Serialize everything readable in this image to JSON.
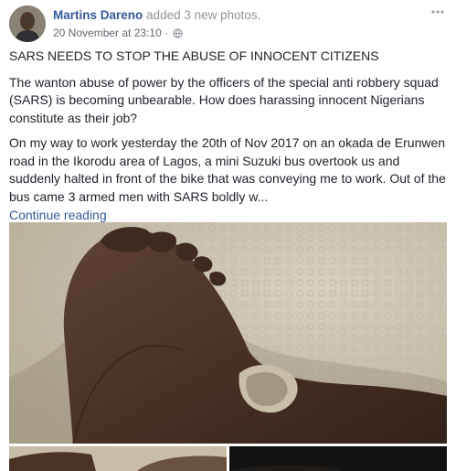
{
  "post": {
    "author": "Martins Dareno",
    "action": "added 3 new photos.",
    "timestamp": "20 November at 23:10",
    "separator": "·",
    "privacy_icon": "globe-icon",
    "more_icon": "more-options-icon",
    "title": "SARS NEEDS TO STOP THE ABUSE OF INNOCENT CITIZENS",
    "paragraph_1": "The wanton abuse of power by the officers of the special anti robbery squad (SARS) is becoming unbearable. How does harassing innocent Nigerians constitute as their job?",
    "paragraph_2": "On my way to work yesterday the 20th of Nov 2017 on an okada de Erunwen road in the Ikorodu area of Lagos, a mini Suzuki bus overtook us and suddenly halted in front of the bike that was conveying me to work. Out of the bus came 3 armed men with SARS boldly w...",
    "continue_label": "Continue reading"
  },
  "colors": {
    "link": "#365899",
    "text": "#1d2129",
    "muted": "#90949c"
  }
}
